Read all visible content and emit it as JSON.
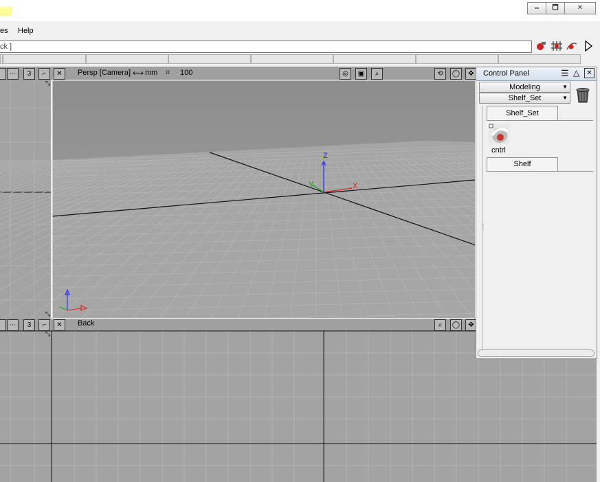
{
  "window": {
    "minimize_glyph": "🗕",
    "maximize_glyph": "🗖",
    "close_glyph": "✕"
  },
  "menu": {
    "items": [
      "es",
      "Help"
    ]
  },
  "command": {
    "value": "ck ]"
  },
  "toolbar_icons": [
    "magnet-icon",
    "grid-snap-icon",
    "curve-snap-icon",
    "play-arrow-icon"
  ],
  "viewport_top": {
    "number_button": "3",
    "camera_label": "Persp [Camera]",
    "unit_label": "mm",
    "grid_value": "100",
    "axis_labels": {
      "z": "Z",
      "x": "X",
      "y": "Y"
    }
  },
  "viewport_bottom": {
    "number_button": "3",
    "camera_label": "Back"
  },
  "control_panel": {
    "title": "Control Panel",
    "module_dropdown": "Modeling",
    "shelfset_dropdown": "Shelf_Set",
    "shelf_tab": "Shelf_Set",
    "shelf_item_label": "cntrl",
    "shelf_button": "Shelf"
  }
}
